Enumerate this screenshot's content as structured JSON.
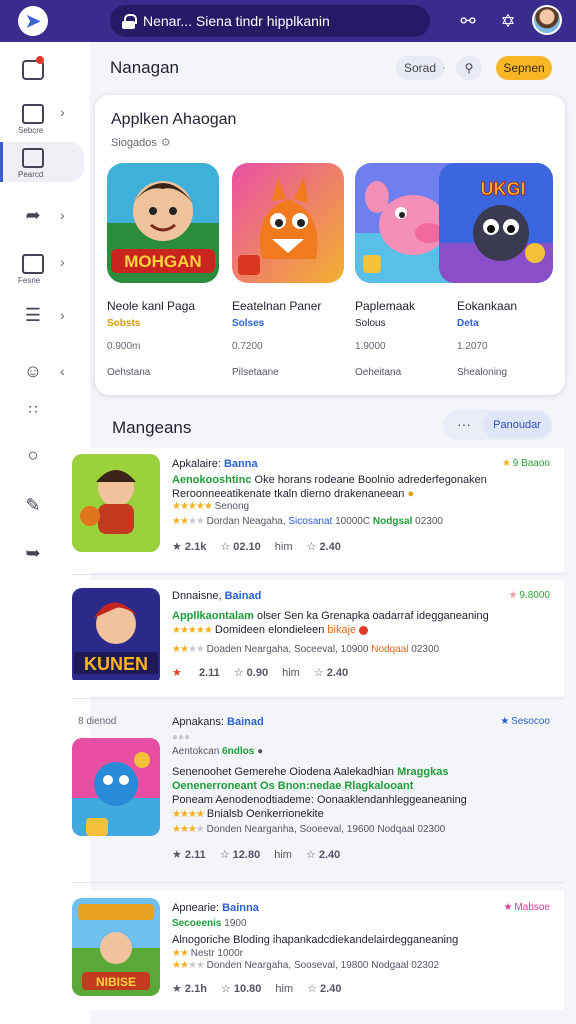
{
  "topbar": {
    "search_text": "Nenar... Siena tindr hipplkanin",
    "icons": [
      "back-arrow-icon",
      "lock-icon",
      "chat-bubble-icon",
      "puzzle-icon",
      "avatar"
    ]
  },
  "sidebar": {
    "items": [
      {
        "label": "",
        "icon": "store-icon"
      },
      {
        "label": "Sebcre",
        "icon": "library-icon"
      },
      {
        "label": "Pearcd",
        "icon": "games-icon"
      },
      {
        "label": "",
        "icon": "share-icon"
      },
      {
        "label": "Fesne",
        "icon": "image-icon"
      },
      {
        "label": "",
        "icon": "list-icon"
      },
      {
        "label": "",
        "icon": "smile-icon"
      },
      {
        "label": "",
        "icon": "grid-icon"
      },
      {
        "label": "",
        "icon": "circle-icon"
      },
      {
        "label": "",
        "icon": "edit-icon"
      },
      {
        "label": "",
        "icon": "feedback-icon"
      }
    ]
  },
  "header": {
    "title": "Nanagan",
    "sort_label": "Sorad",
    "sort_sep": "·",
    "cta_label": "Sepnen"
  },
  "featured": {
    "title": "Applken Ahaogan",
    "subtitle": "Siogados",
    "items": [
      {
        "art_text": "MOHGAN",
        "name": "Neole kanl Paga",
        "tag": "Sobsts",
        "size": "0.900m",
        "dev": "Oehstana"
      },
      {
        "art_text": "",
        "name": "Eeatelnan Paner",
        "tag": "Solses",
        "size": "0.7200",
        "dev": "Pilsetaane"
      },
      {
        "art_text": "",
        "name": "Paplemaak",
        "tag": "Solous",
        "size": "1.9000",
        "dev": "Oeheitana"
      },
      {
        "art_text": "UKGI",
        "name": "Eokankaan",
        "tag": "Deta",
        "size": "1.2070",
        "dev": "Shealoning"
      }
    ]
  },
  "section": {
    "title": "Mangeans",
    "more_label": "···",
    "filter_label": "Panoudar"
  },
  "side_note": "8 dienod",
  "rows": [
    {
      "title": "Apkalaire:",
      "title_accent": "Banna",
      "badge": "9 Baaoo",
      "badge_color": "#2ba43a",
      "line1a": "Aenokooshtinc",
      "line1b": " Oke horans rodeane Boolnio adrederfegonaken",
      "line2": "Reroonneeatikenate tkaln dierno drakenaneean",
      "line3": "Senong",
      "meta_a": "Dordan Neagaha,",
      "meta_b": "Sicosanat",
      "meta_c": " 10000C",
      "meta_d": "Nodgsal",
      "meta_e": " 02300",
      "foot": [
        "2.1k",
        "02.10",
        "him",
        "2.40"
      ],
      "art_text": ""
    },
    {
      "title": "Dnnaisne,",
      "title_accent": "Bainad",
      "badge": "9.8000",
      "badge_color": "#2ba43a",
      "line1a": "Appllkaontalam",
      "line1b": " olser Sen ka Grenapka oadarraf idegganeaning",
      "line2": "Domideen elondieleen",
      "line3": "",
      "meta_a": "Doaden Neargaha,",
      "meta_b": "Soceeval,",
      "meta_c": " 10900",
      "meta_d": "Nodqaal",
      "meta_e": " 02300",
      "foot": [
        "2.11",
        "0.90",
        "him",
        "2.40"
      ],
      "art_text": "KUNEN",
      "line2_accent": "bikaje"
    },
    {
      "title": "Apnakans:",
      "title_accent": "Bainad",
      "badge": "Sesocoo",
      "badge_color": "#2b62d6",
      "line1a": "Aentokcan",
      "line1b": "6ndlos",
      "line1c": "Senenoohet Gemerehe Oiodena Aalekadhian",
      "line1d": "Mraggkas",
      "line2": "Oenenerroneant Os Bnon:nedae Rlagkalooant",
      "line3": "Poneam Aenodenodtiademe: Oonaaklendanhleggeaneaning",
      "line4": "Bnialsb Oenkerrionekite",
      "meta_a": "Donden Nearganha,",
      "meta_b": "Sooeeval,",
      "meta_c": " 19600",
      "meta_d": "Nodqaal",
      "meta_e": " 02300",
      "foot": [
        "2.11",
        "12.80",
        "him",
        "2.40"
      ],
      "art_text": ""
    },
    {
      "title": "Apnearie:",
      "title_accent": "Bainna",
      "badge": "Mabsoe",
      "badge_color": "#d63d9c",
      "line1a": "Secoeenis",
      "line1b": " 1900",
      "line2": "Alnogoriche Bloding ihapankadcdiekandelairdegganeaning",
      "line3": "Nestr 1000r",
      "meta_a": "Donden Neargaha,",
      "meta_b": "Sooseval,",
      "meta_c": " 19800",
      "meta_d": "Nodgaal",
      "meta_e": " 02302",
      "foot": [
        "2.1h",
        "10.80",
        "him",
        "2.40"
      ],
      "art_text": "NIBISE"
    }
  ],
  "colors": {
    "topbar": "#3a2c8c",
    "accent": "#2b62d6",
    "cta": "#f6b626",
    "star": "#f2b01e"
  }
}
